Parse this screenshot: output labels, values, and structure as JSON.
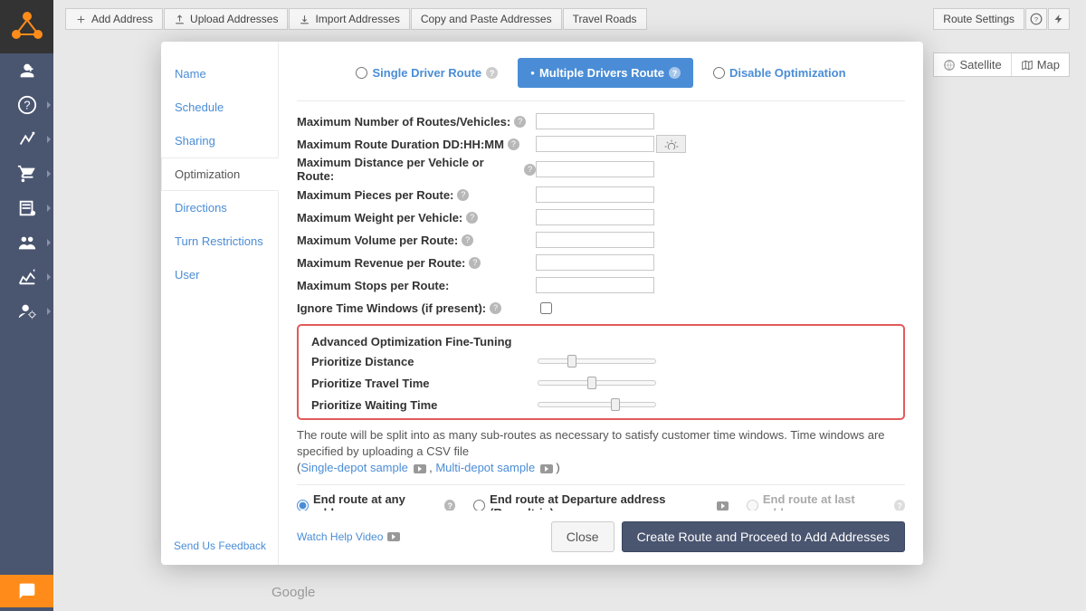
{
  "toolbar": {
    "add_address": "Add Address",
    "upload_addresses": "Upload Addresses",
    "import_addresses": "Import Addresses",
    "copy_paste": "Copy and Paste Addresses",
    "travel_roads": "Travel Roads",
    "route_settings": "Route Settings"
  },
  "map_controls": {
    "satellite": "Satellite",
    "map": "Map"
  },
  "modal": {
    "tabs": {
      "name": "Name",
      "schedule": "Schedule",
      "sharing": "Sharing",
      "optimization": "Optimization",
      "directions": "Directions",
      "turn_restrictions": "Turn Restrictions",
      "user": "User"
    },
    "route_type": {
      "single": "Single Driver Route",
      "multiple": "Multiple Drivers Route",
      "disable": "Disable Optimization"
    },
    "fields": {
      "max_routes": "Maximum Number of Routes/Vehicles:",
      "max_duration": "Maximum Route Duration DD:HH:MM",
      "max_distance": "Maximum Distance per Vehicle or Route:",
      "max_pieces": "Maximum Pieces per Route:",
      "max_weight": "Maximum Weight per Vehicle:",
      "max_volume": "Maximum Volume per Route:",
      "max_revenue": "Maximum Revenue per Route:",
      "max_stops": "Maximum Stops per Route:",
      "ignore_time": "Ignore Time Windows (if present):"
    },
    "advanced": {
      "title": "Advanced Optimization Fine-Tuning",
      "prioritize_distance": "Prioritize Distance",
      "prioritize_travel": "Prioritize Travel Time",
      "prioritize_waiting": "Prioritize Waiting Time"
    },
    "help_text": "The route will be split into as many sub-routes as necessary to satisfy customer time windows. Time windows are specified by uploading a CSV file",
    "single_depot": "Single-depot sample",
    "multi_depot": "Multi-depot sample",
    "end_route": {
      "any": "End route at any address",
      "departure": "End route at Departure address (Roundtrip)",
      "last": "End route at last address"
    },
    "feedback": "Send Us Feedback",
    "watch_video": "Watch Help Video",
    "close": "Close",
    "create": "Create Route and Proceed to Add Addresses"
  },
  "google": "Google"
}
